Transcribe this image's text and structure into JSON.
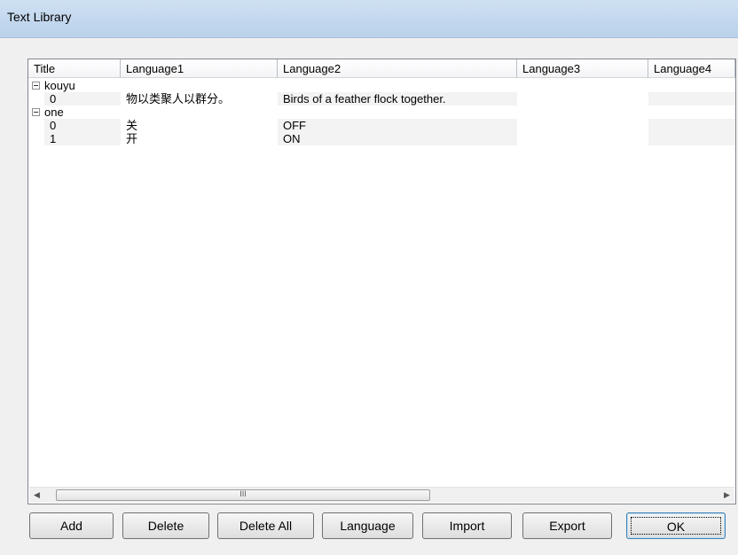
{
  "window": {
    "title": "Text Library"
  },
  "table": {
    "columns": [
      "Title",
      "Language1",
      "Language2",
      "Language3",
      "Language4"
    ],
    "groups": [
      {
        "name": "kouyu",
        "rows": [
          {
            "title": "0",
            "lang1": "物以类聚人以群分。",
            "lang2": "Birds of a feather flock together.",
            "lang3": "",
            "lang4": ""
          }
        ]
      },
      {
        "name": "one",
        "rows": [
          {
            "title": "0",
            "lang1": "关",
            "lang2": "OFF",
            "lang3": "",
            "lang4": ""
          },
          {
            "title": "1",
            "lang1": "开",
            "lang2": "ON",
            "lang3": "",
            "lang4": ""
          }
        ]
      }
    ]
  },
  "scrollbar": {
    "left_arrow": "◀",
    "right_arrow": "▶",
    "thumb_grip": "III"
  },
  "buttons": {
    "add": "Add",
    "delete": "Delete",
    "delete_all": "Delete All",
    "language": "Language",
    "import": "Import",
    "export": "Export",
    "ok": "OK"
  }
}
